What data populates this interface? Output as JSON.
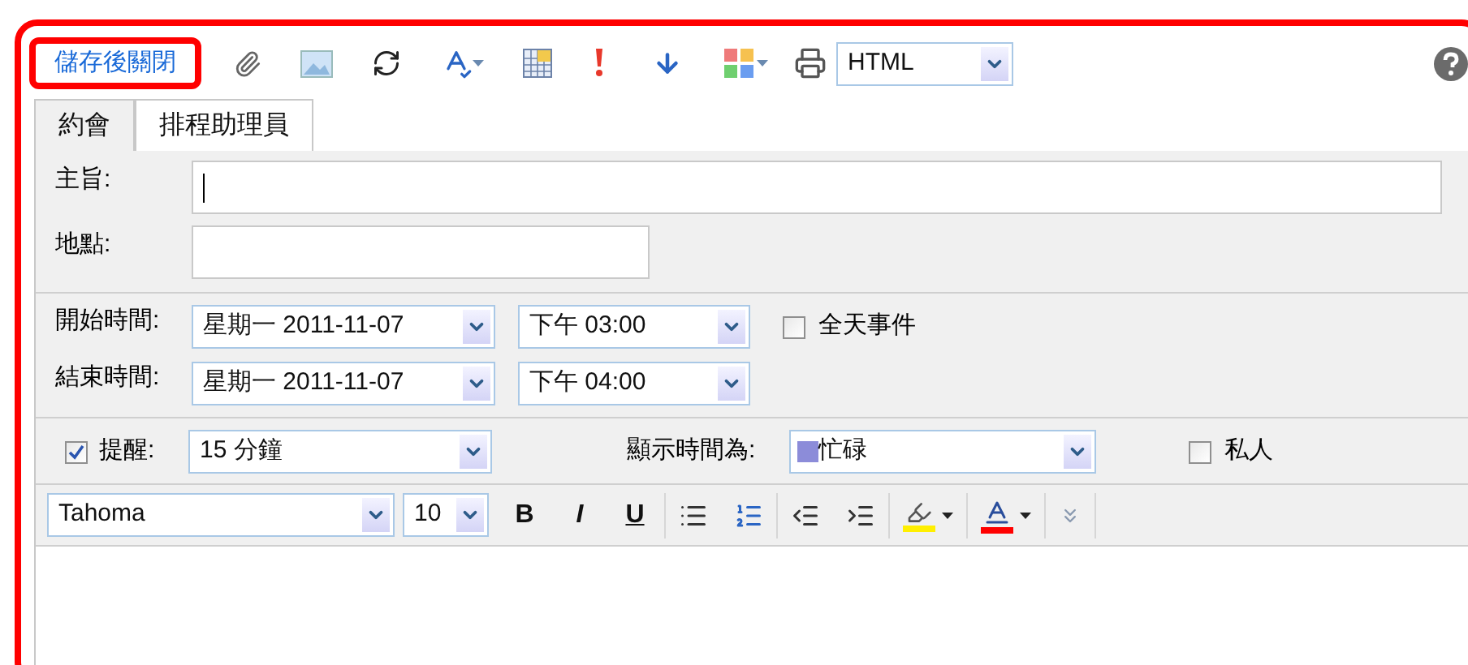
{
  "toolbar": {
    "save_close": "儲存後關閉",
    "format_select": "HTML"
  },
  "tabs": [
    {
      "label": "約會",
      "selected": true
    },
    {
      "label": "排程助理員",
      "selected": false
    }
  ],
  "subject": {
    "label": "主旨:",
    "focused": true
  },
  "location": {
    "label": "地點:"
  },
  "start": {
    "label": "開始時間:",
    "date": "星期一 2011-11-07",
    "time": "下午 03:00"
  },
  "end": {
    "label": "結束時間:",
    "date": "星期一 2011-11-07",
    "time": "下午 04:00"
  },
  "all_day": {
    "label": "全天事件",
    "checked": false
  },
  "reminder": {
    "label": "提醒:",
    "checked": true,
    "value": "15 分鐘"
  },
  "show_as": {
    "label": "顯示時間為:",
    "value": "忙碌",
    "color": "#8c8cd9"
  },
  "private": {
    "label": "私人",
    "checked": false
  },
  "format_bar": {
    "font": "Tahoma",
    "size": "10",
    "style_buttons": [
      {
        "label": "B",
        "kind": "bold"
      },
      {
        "label": "I",
        "kind": "italic"
      },
      {
        "label": "U",
        "kind": "underline"
      }
    ]
  }
}
